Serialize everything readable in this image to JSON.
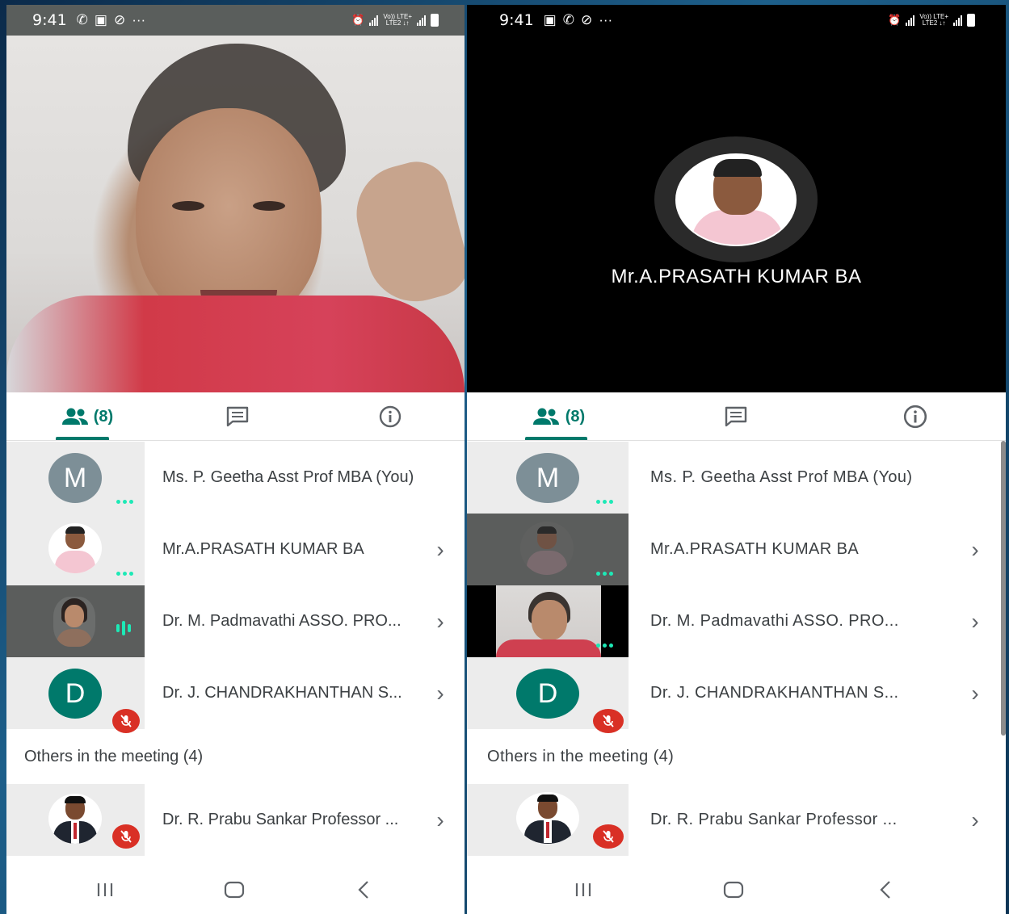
{
  "status_bar": {
    "time": "9:41",
    "overflow": "···",
    "network_top": "Vo)) LTE+",
    "network_bottom": "LTE2 ↓↑"
  },
  "left_phone": {
    "tabs": {
      "people_count": "(8)"
    },
    "participants": [
      {
        "name": "Ms. P. Geetha Asst Prof MBA (You)",
        "avatar_letter": "M",
        "avatar_color": "#7d8f97",
        "state": "dots"
      },
      {
        "name": "Mr.A.PRASATH KUMAR BA",
        "state": "dots"
      },
      {
        "name": "Dr. M. Padmavathi ASSO. PRO...",
        "state": "speaking"
      },
      {
        "name": "Dr. J. CHANDRAKHANTHAN S...",
        "avatar_letter": "D",
        "avatar_color": "#00796b",
        "state": "muted"
      }
    ],
    "others_header": "Others in the meeting (4)",
    "others": [
      {
        "name": "Dr. R. Prabu Sankar Professor ...",
        "state": "muted"
      }
    ]
  },
  "right_phone": {
    "video_name": "Mr.A.PRASATH KUMAR BA",
    "tabs": {
      "people_count": "(8)"
    },
    "participants": [
      {
        "name": "Ms. P. Geetha Asst Prof MBA (You)",
        "avatar_letter": "M",
        "avatar_color": "#7d8f97",
        "state": "dots"
      },
      {
        "name": "Mr.A.PRASATH KUMAR BA",
        "state": "dots"
      },
      {
        "name": "Dr. M. Padmavathi ASSO. PRO...",
        "state": "dots"
      },
      {
        "name": "Dr. J. CHANDRAKHANTHAN S...",
        "avatar_letter": "D",
        "avatar_color": "#00796b",
        "state": "muted"
      }
    ],
    "others_header": "Others in the meeting (4)",
    "others": [
      {
        "name": "Dr. R. Prabu Sankar Professor ...",
        "state": "muted"
      }
    ]
  },
  "colors": {
    "accent": "#00796b",
    "speaking": "#1de9b6",
    "muted": "#d93025"
  },
  "icons": [
    "people-icon",
    "chat-icon",
    "info-icon",
    "chevron-right-icon",
    "mic-off-icon",
    "recents-icon",
    "home-icon",
    "back-icon"
  ]
}
